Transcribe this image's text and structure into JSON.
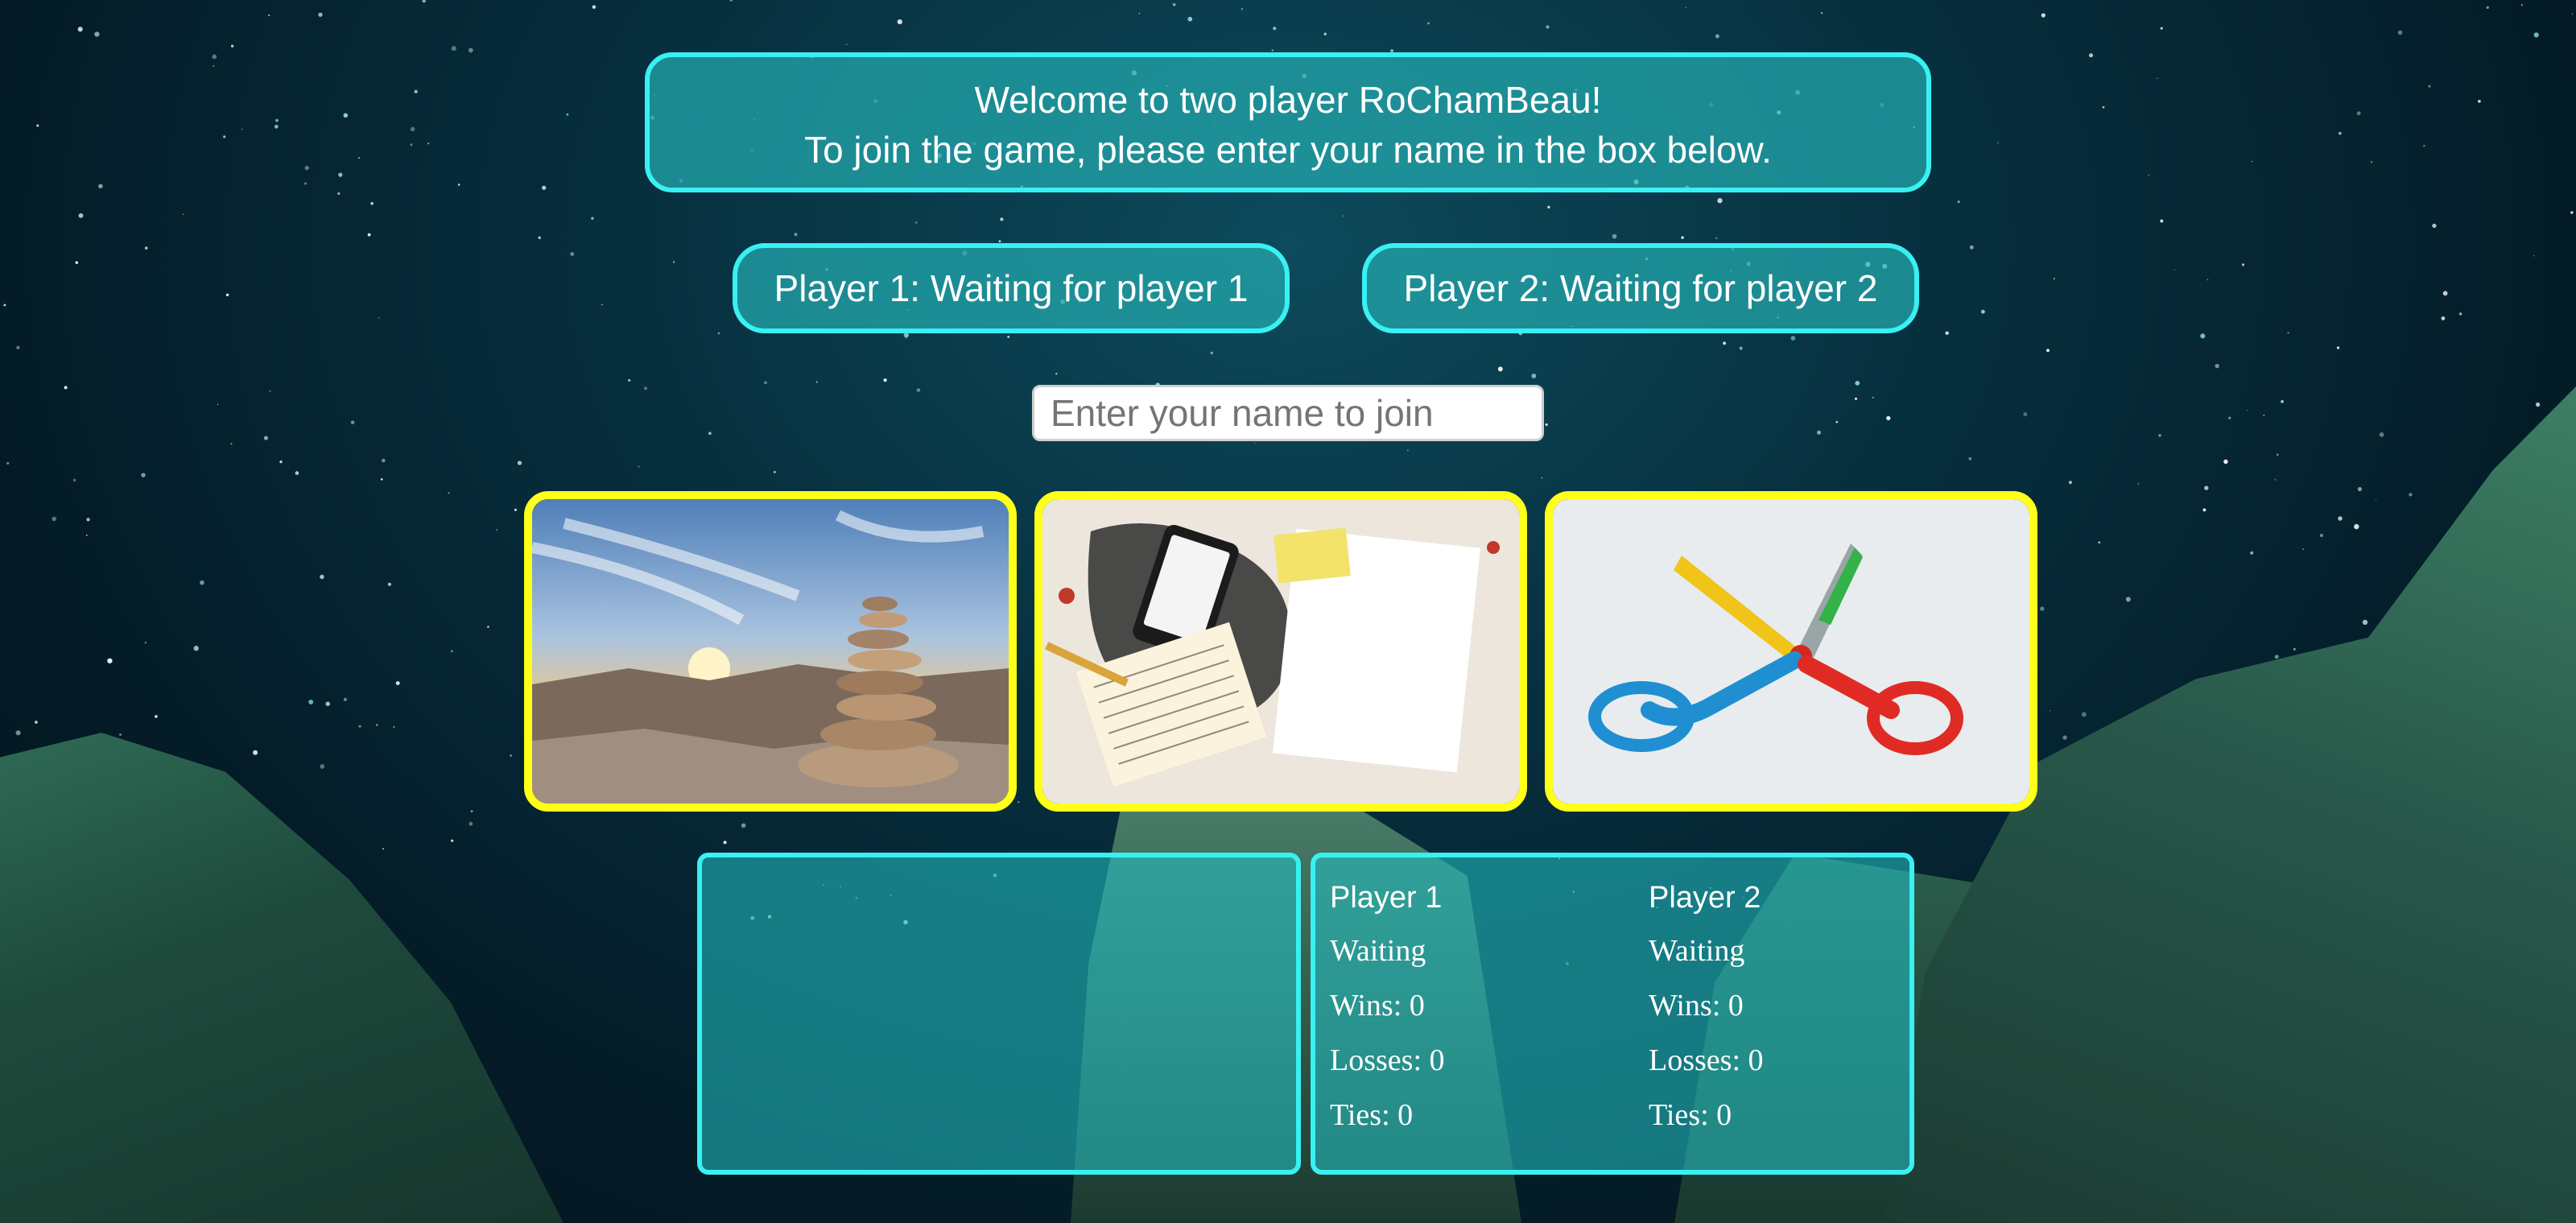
{
  "welcome": {
    "line1": "Welcome to two player RoChamBeau!",
    "line2": "To join the game, please enter your name in the box below."
  },
  "players": {
    "p1_status": "Player 1: Waiting for player 1",
    "p2_status": "Player 2: Waiting for player 2"
  },
  "join": {
    "placeholder": "Enter your name to join",
    "value": ""
  },
  "choices": [
    {
      "name": "rock",
      "icon": "rock-cairn-image"
    },
    {
      "name": "paper",
      "icon": "paper-sheets-image"
    },
    {
      "name": "scissors",
      "icon": "scissors-image"
    }
  ],
  "scoreboard": {
    "player1": {
      "header": "Player 1",
      "status": "Waiting",
      "wins": "Wins: 0",
      "losses": "Losses: 0",
      "ties": "Ties: 0"
    },
    "player2": {
      "header": "Player 2",
      "status": "Waiting",
      "wins": "Wins: 0",
      "losses": "Losses: 0",
      "ties": "Ties: 0"
    }
  },
  "colors": {
    "panel_border": "#39f0f2",
    "panel_fill": "#24acb0",
    "choice_border": "#ffff1a",
    "text": "#ffffff"
  }
}
